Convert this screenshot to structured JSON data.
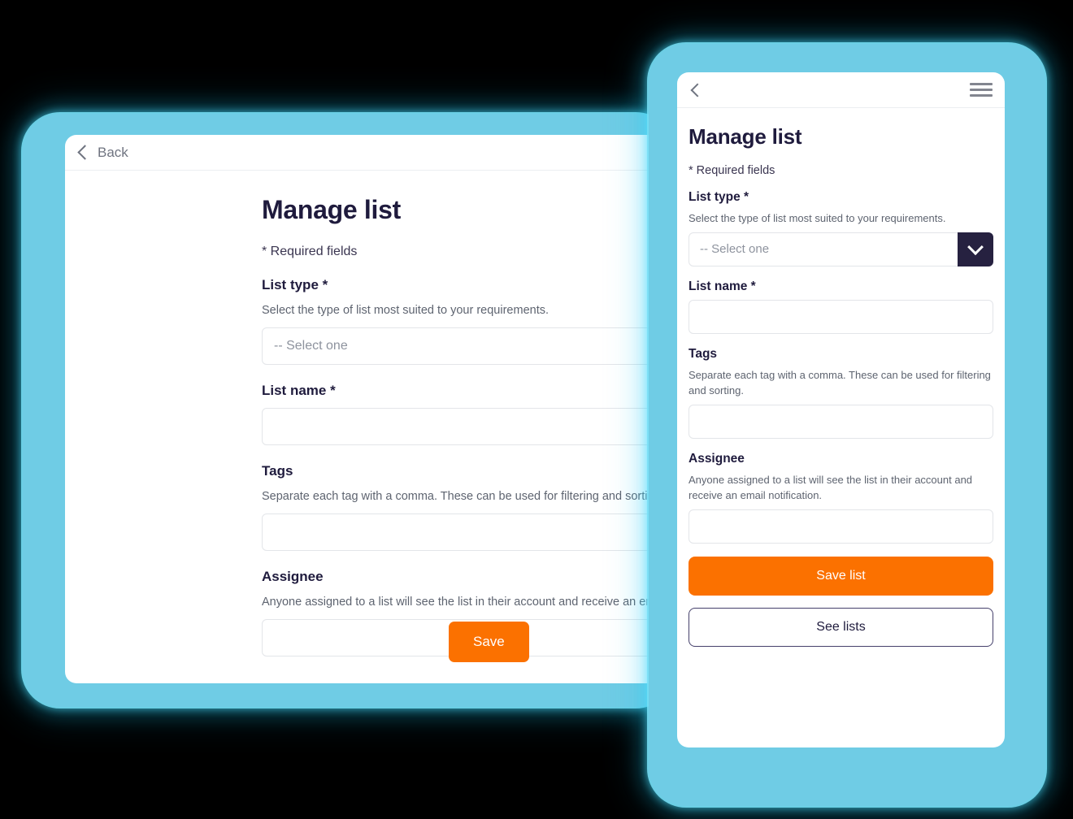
{
  "colors": {
    "background": "#000000",
    "frame_cyan": "#6FCCE5",
    "accent_orange": "#FB7100",
    "dark_navy": "#262140",
    "heading": "#1F1B3D"
  },
  "desktop_panel": {
    "topbar": {
      "back_label": "Back",
      "back_icon": "chevron-left-icon"
    },
    "title": "Manage list",
    "required_note": "* Required fields",
    "fields": [
      {
        "label": "List type *",
        "help": "Select the type of list most suited to your requirements.",
        "placeholder": "-- Select one",
        "value": ""
      },
      {
        "label": "List name *",
        "help": "",
        "placeholder": "",
        "value": ""
      },
      {
        "label": "Tags",
        "help": "Separate each tag with a comma. These can be used for filtering and sorting.",
        "placeholder": "",
        "value": ""
      },
      {
        "label": "Assignee",
        "help": "Anyone assigned to a list will see the list in their account and receive an email notific",
        "placeholder": "",
        "value": ""
      }
    ],
    "save_label": "Save"
  },
  "mobile_panel": {
    "topbar": {
      "back_icon": "chevron-left-icon",
      "menu_icon": "hamburger-menu-icon"
    },
    "title": "Manage list",
    "required_note": "* Required fields",
    "fields": [
      {
        "label": "List type *",
        "help": "Select the type of list most suited to your requirements.",
        "placeholder": "-- Select one",
        "value": ""
      },
      {
        "label": "List name *",
        "help": "",
        "placeholder": "",
        "value": ""
      },
      {
        "label": "Tags",
        "help": "Separate each tag with a comma. These can be used for filtering and sorting.",
        "placeholder": "",
        "value": ""
      },
      {
        "label": "Assignee",
        "help": "Anyone assigned to a list will see the list in their account and receive an email notification.",
        "placeholder": "",
        "value": ""
      }
    ],
    "save_label": "Save list",
    "see_lists_label": "See lists"
  }
}
